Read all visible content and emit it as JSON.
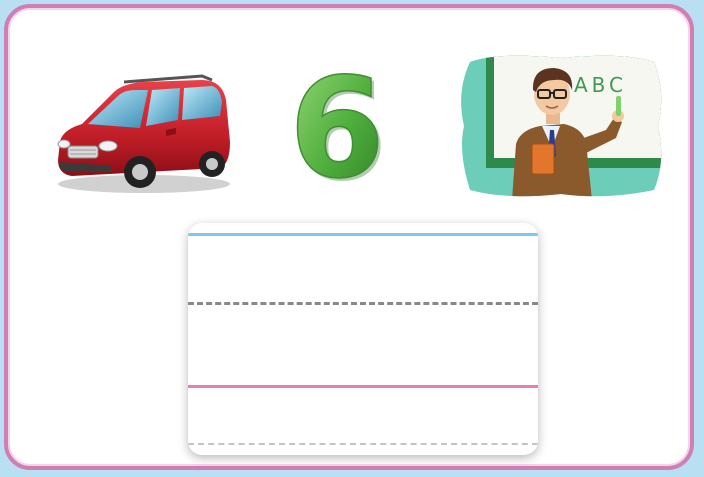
{
  "card": {
    "border_color": "#d07fb4",
    "background": "#ffffff"
  },
  "pictures": [
    {
      "name": "red-minivan-icon",
      "description_color": "#c8202a"
    },
    {
      "name": "number-six-icon",
      "glyph": "6",
      "color": "#5cb84a"
    },
    {
      "name": "teacher-at-board-icon",
      "board_text": "ABC"
    }
  ],
  "writing_lines": {
    "top_line_color": "#7cc8ee",
    "midline_color": "#888888",
    "baseline_color": "#e77fb5",
    "bottom_line_color": "#c4c4c4"
  }
}
